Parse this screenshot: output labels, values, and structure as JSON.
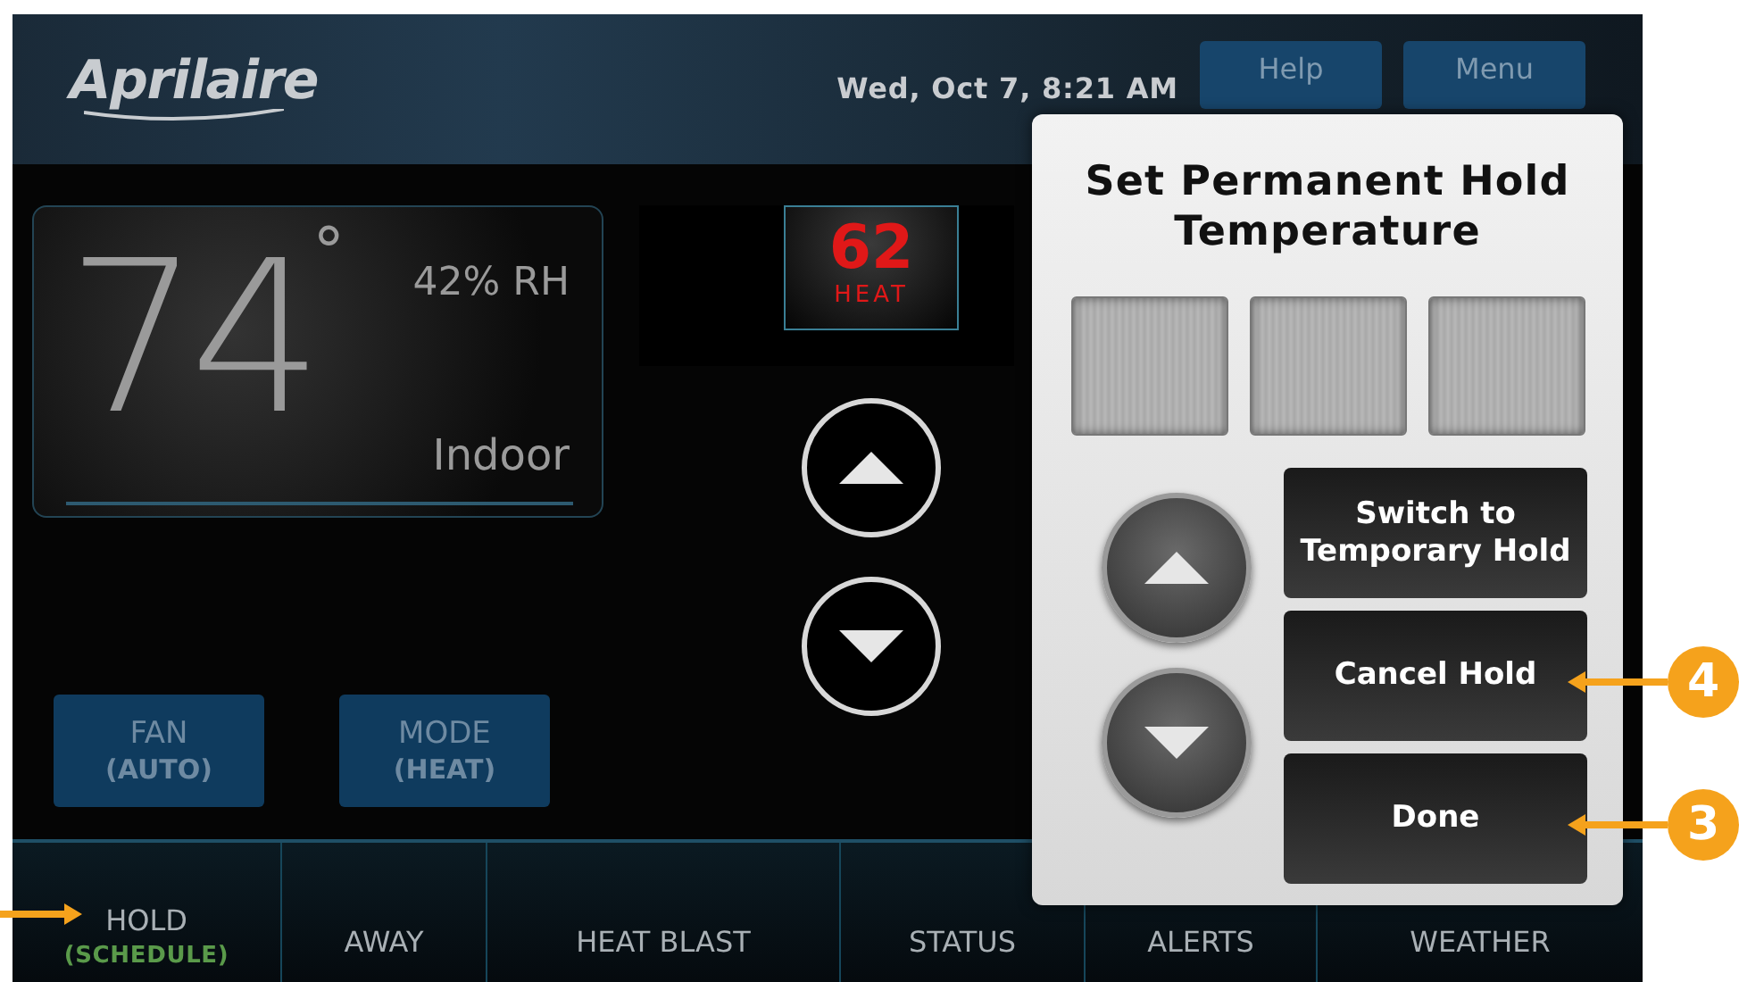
{
  "header": {
    "logo": "Aprilaire",
    "datetime": "Wed, Oct 7, 8:21 AM",
    "buttons": [
      "Help",
      "Menu"
    ]
  },
  "indoor": {
    "temperature": "74",
    "degree": "°",
    "humidity": "42% RH",
    "label": "Indoor"
  },
  "setpoint": {
    "value": "62",
    "mode": "HEAT"
  },
  "controls": [
    {
      "label": "FAN",
      "value": "(AUTO)"
    },
    {
      "label": "MODE",
      "value": "(HEAT)"
    }
  ],
  "nav": [
    {
      "label": "HOLD",
      "sub": "(SCHEDULE)"
    },
    {
      "label": "AWAY"
    },
    {
      "label": "HEAT BLAST"
    },
    {
      "label": "STATUS"
    },
    {
      "label": "ALERTS"
    },
    {
      "label": "WEATHER"
    }
  ],
  "dialog": {
    "title": "Set Permanent Hold Temperature",
    "buttons": [
      "Switch to Temporary Hold",
      "Cancel Hold",
      "Done"
    ]
  },
  "callouts": [
    {
      "number": "4"
    },
    {
      "number": "3"
    }
  ]
}
